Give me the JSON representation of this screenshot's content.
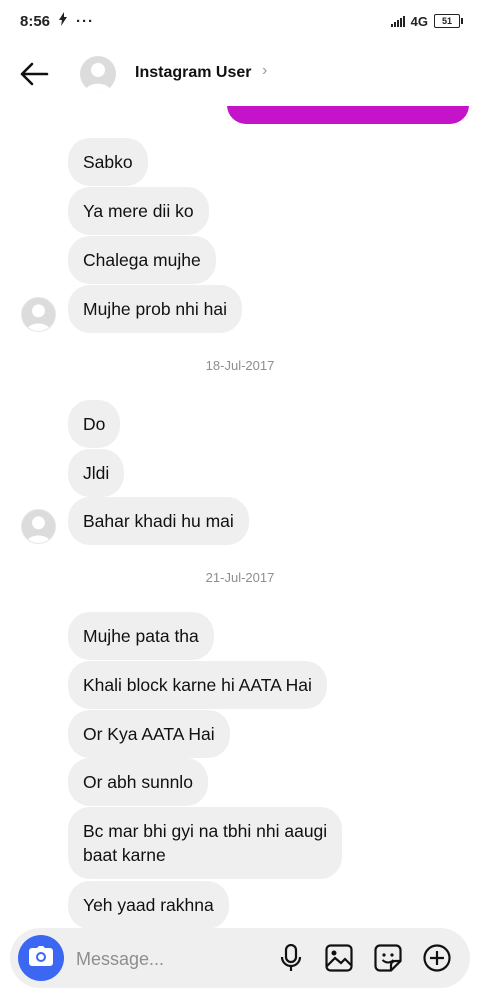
{
  "status_bar": {
    "time": "8:56",
    "dots": "···",
    "network": "4G",
    "battery": "51"
  },
  "header": {
    "name": "Instagram User",
    "chevron": "›"
  },
  "messages": [
    {
      "text": "Sabko"
    },
    {
      "text": "Ya mere dii ko"
    },
    {
      "text": "Chalega mujhe"
    },
    {
      "text": "Mujhe prob nhi hai"
    },
    {
      "text": "Do"
    },
    {
      "text": "Jldi"
    },
    {
      "text": "Bahar khadi hu mai"
    },
    {
      "text": "Mujhe pata tha"
    },
    {
      "text": "Khali block karne hi AATA Hai"
    },
    {
      "text": "Or Kya AATA Hai"
    },
    {
      "text": "Or abh sunnlo"
    },
    {
      "text": "Bc mar bhi gyi na tbhi nhi aaugi\nbaat karne"
    },
    {
      "text": "Yeh yaad rakhna"
    }
  ],
  "dates": [
    "18-Jul-2017",
    "21-Jul-2017"
  ],
  "composer": {
    "placeholder": "Message..."
  },
  "colors": {
    "sent_bubble": "#c513c9",
    "received_bubble": "#efefef",
    "camera_button": "#3b67f3",
    "date_text": "#8e8e8e"
  },
  "icons": [
    "back-arrow-icon",
    "camera-icon",
    "microphone-icon",
    "gallery-icon",
    "sticker-icon",
    "add-icon"
  ]
}
